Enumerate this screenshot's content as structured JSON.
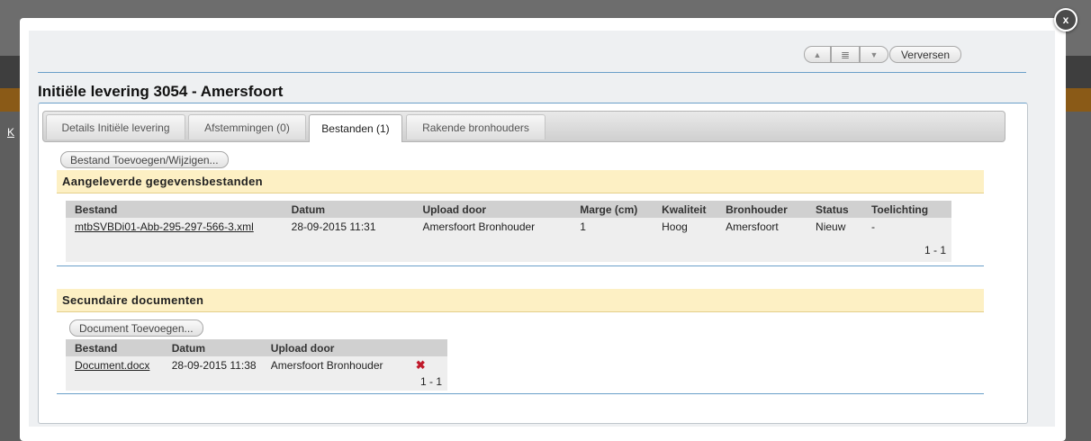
{
  "background": {
    "fragment": "K"
  },
  "nav": {
    "up_icon": "triangle-up-icon",
    "list_icon": "list-icon",
    "down_icon": "triangle-down-icon",
    "refresh_label": "Verversen"
  },
  "close": {
    "glyph": "x"
  },
  "page": {
    "title": "Initiële levering 3054 - Amersfoort"
  },
  "tabs": [
    {
      "label": "Details Initiële levering"
    },
    {
      "label": "Afstemmingen (0)"
    },
    {
      "label": "Bestanden (1)"
    },
    {
      "label": "Rakende bronhouders"
    }
  ],
  "files": {
    "button_label": "Bestand Toevoegen/Wijzigen...",
    "section_title": "Aangeleverde gegevensbestanden",
    "columns": [
      "Bestand",
      "Datum",
      "Upload door",
      "Marge (cm)",
      "Kwaliteit",
      "Bronhouder",
      "Status",
      "Toelichting"
    ],
    "rows": [
      [
        "mtbSVBDi01-Abb-295-297-566-3.xml",
        "28-09-2015 11:31",
        "Amersfoort Bronhouder",
        "1",
        "Hoog",
        "Amersfoort",
        "Nieuw",
        "-"
      ]
    ],
    "pager": "1 - 1"
  },
  "secondary": {
    "section_title": "Secundaire documenten",
    "button_label": "Document Toevoegen...",
    "columns": [
      "Bestand",
      "Datum",
      "Upload door"
    ],
    "rows": [
      [
        "Document.docx",
        "28-09-2015 11:38",
        "Amersfoort Bronhouder"
      ]
    ],
    "delete_icon": "✖",
    "pager": "1 - 1"
  },
  "colors": {
    "accent_line": "#6a9fc9",
    "section_bg": "#fdf0c4",
    "delete": "#c0192a"
  }
}
